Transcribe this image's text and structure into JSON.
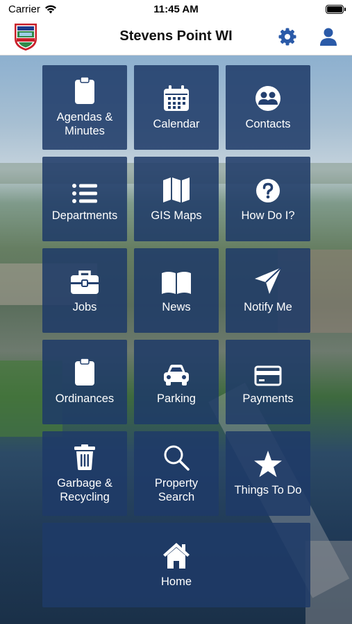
{
  "status_bar": {
    "carrier": "Carrier",
    "time": "11:45 AM"
  },
  "header": {
    "title": "Stevens Point WI",
    "logo_icon": "city-seal-icon",
    "settings_icon": "gear-icon",
    "profile_icon": "person-icon",
    "accent_color": "#2a5aa8"
  },
  "tiles": [
    {
      "label": "Agendas &\nMinutes",
      "icon": "clipboard-icon"
    },
    {
      "label": "Calendar",
      "icon": "calendar-icon"
    },
    {
      "label": "Contacts",
      "icon": "users-icon"
    },
    {
      "label": "Departments",
      "icon": "list-icon"
    },
    {
      "label": "GIS Maps",
      "icon": "map-icon"
    },
    {
      "label": "How Do I?",
      "icon": "question-icon"
    },
    {
      "label": "Jobs",
      "icon": "briefcase-icon"
    },
    {
      "label": "News",
      "icon": "book-icon"
    },
    {
      "label": "Notify Me",
      "icon": "send-icon"
    },
    {
      "label": "Ordinances",
      "icon": "clipboard-icon"
    },
    {
      "label": "Parking",
      "icon": "car-icon"
    },
    {
      "label": "Payments",
      "icon": "credit-card-icon"
    },
    {
      "label": "Garbage &\nRecycling",
      "icon": "trash-icon"
    },
    {
      "label": "Property\nSearch",
      "icon": "search-icon"
    },
    {
      "label": "Things To Do",
      "icon": "star-icon"
    },
    {
      "label": "Home",
      "icon": "home-icon"
    }
  ],
  "colors": {
    "tile_background": "#1e3a68",
    "tile_text": "#ffffff"
  }
}
